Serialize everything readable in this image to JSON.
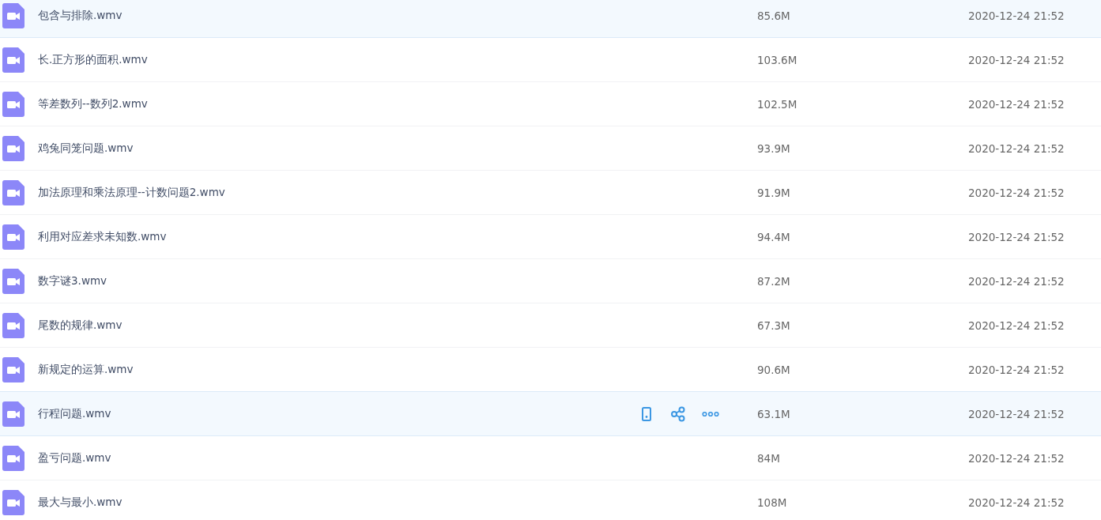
{
  "files": [
    {
      "name": "包含与排除.wmv",
      "size": "85.6M",
      "modified": "2020-12-24 21:52",
      "highlighted": true,
      "show_actions": false
    },
    {
      "name": "长.正方形的面积.wmv",
      "size": "103.6M",
      "modified": "2020-12-24 21:52",
      "highlighted": false,
      "show_actions": false
    },
    {
      "name": "等差数列--数列2.wmv",
      "size": "102.5M",
      "modified": "2020-12-24 21:52",
      "highlighted": false,
      "show_actions": false
    },
    {
      "name": "鸡兔同笼问题.wmv",
      "size": "93.9M",
      "modified": "2020-12-24 21:52",
      "highlighted": false,
      "show_actions": false
    },
    {
      "name": "加法原理和乘法原理--计数问题2.wmv",
      "size": "91.9M",
      "modified": "2020-12-24 21:52",
      "highlighted": false,
      "show_actions": false
    },
    {
      "name": "利用对应差求未知数.wmv",
      "size": "94.4M",
      "modified": "2020-12-24 21:52",
      "highlighted": false,
      "show_actions": false
    },
    {
      "name": "数字谜3.wmv",
      "size": "87.2M",
      "modified": "2020-12-24 21:52",
      "highlighted": false,
      "show_actions": false
    },
    {
      "name": "尾数的规律.wmv",
      "size": "67.3M",
      "modified": "2020-12-24 21:52",
      "highlighted": false,
      "show_actions": false
    },
    {
      "name": "新规定的运算.wmv",
      "size": "90.6M",
      "modified": "2020-12-24 21:52",
      "highlighted": false,
      "show_actions": false
    },
    {
      "name": "行程问题.wmv",
      "size": "63.1M",
      "modified": "2020-12-24 21:52",
      "highlighted": true,
      "show_actions": true
    },
    {
      "name": "盈亏问题.wmv",
      "size": "84M",
      "modified": "2020-12-24 21:52",
      "highlighted": false,
      "show_actions": false
    },
    {
      "name": "最大与最小.wmv",
      "size": "108M",
      "modified": "2020-12-24 21:52",
      "highlighted": false,
      "show_actions": false
    }
  ]
}
